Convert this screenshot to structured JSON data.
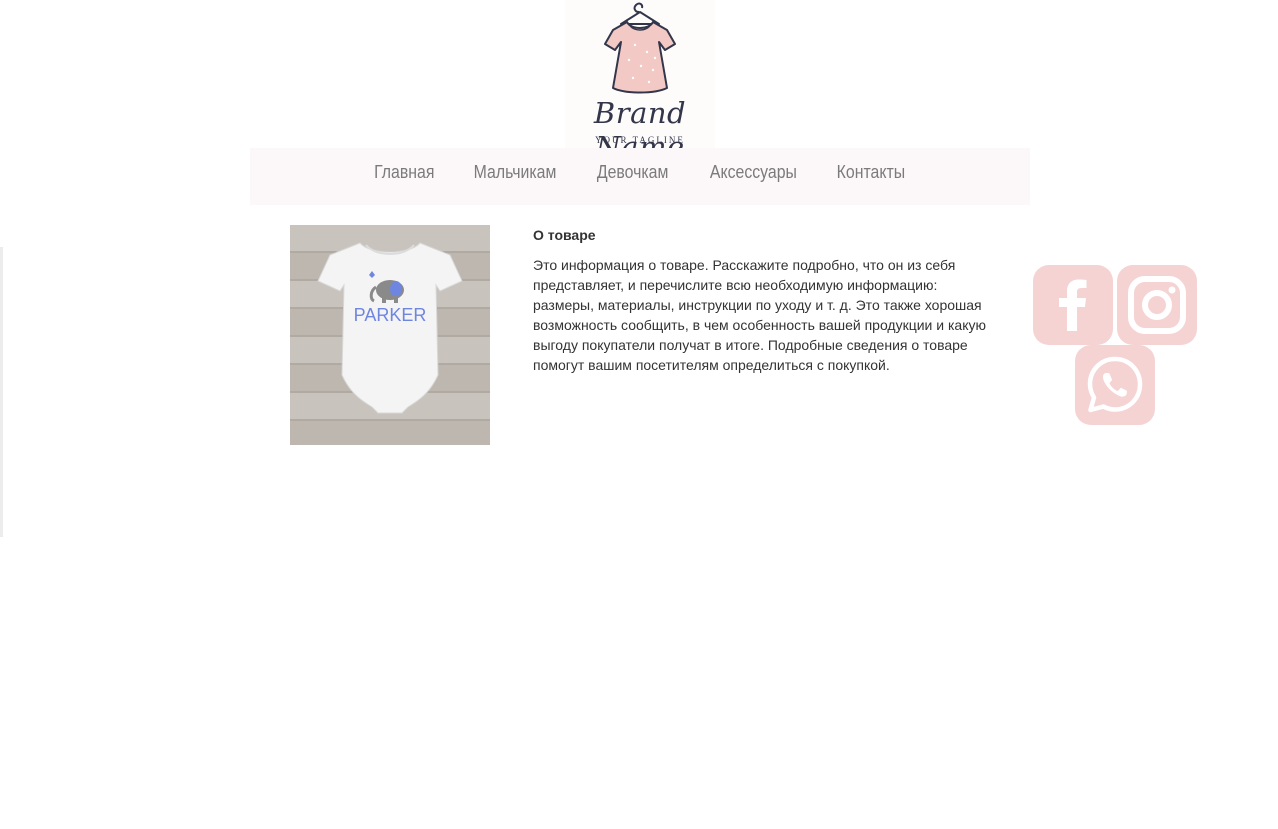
{
  "logo": {
    "brand_name": "Brand Name",
    "tagline": "YOUR TAGLINE"
  },
  "nav": {
    "items": [
      {
        "label": "Главная"
      },
      {
        "label": "Мальчикам"
      },
      {
        "label": "Девочкам"
      },
      {
        "label": "Аксессуары"
      },
      {
        "label": "Контакты"
      }
    ]
  },
  "product": {
    "image_text": "PARKER",
    "title": "О товаре",
    "description": "Это информация о товаре. Расскажите подробно, что он из себя представляет, и перечислите всю необходимую информацию: размеры, материалы, инструкции по уходу и т. д. Это также хорошая возможность сообщить, в чем особенность вашей продукции и какую выгоду покупатели получат в итоге. Подробные сведения о товаре помогут вашим посетителям определиться с покупкой."
  },
  "social": {
    "color": "#f5d3d3",
    "icons": [
      "facebook-icon",
      "instagram-icon",
      "whatsapp-icon"
    ]
  },
  "colors": {
    "nav_background": "#fcf7f9",
    "nav_text": "#7b7b7b",
    "body_text": "#333333"
  }
}
